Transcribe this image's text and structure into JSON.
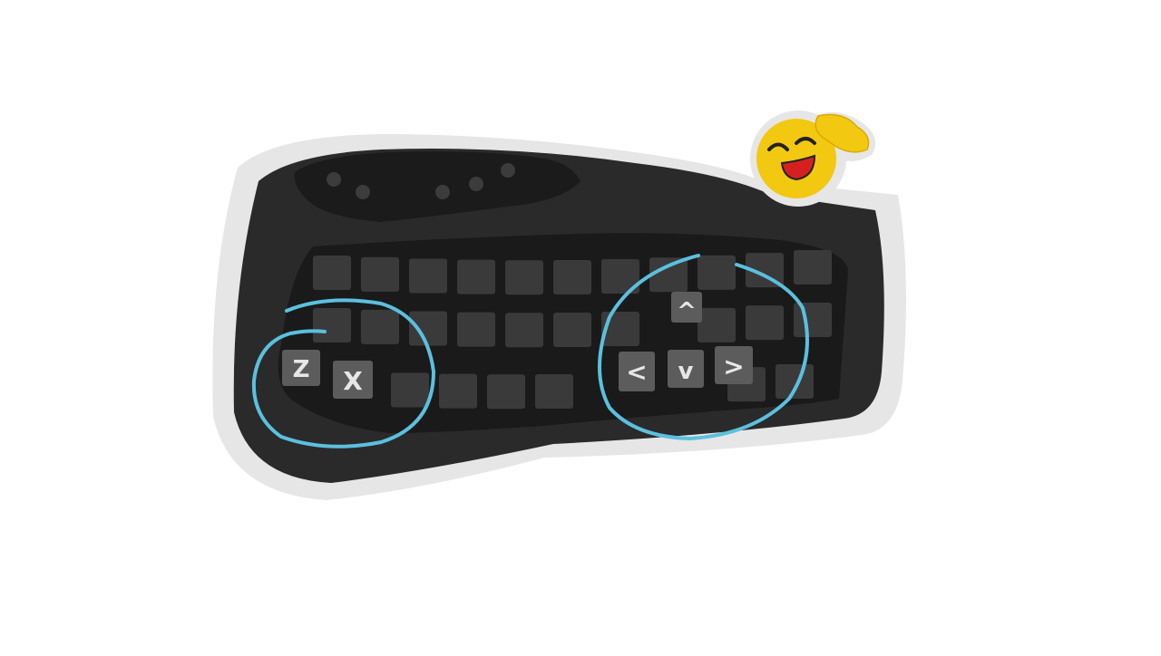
{
  "colors": {
    "background": "#ffffff",
    "sticker_outline": "#e6e6e6",
    "keyboard_body": "#2a2a2a",
    "keyboard_top": "#1b1b1b",
    "key_well": "#1a1a1a",
    "key_dark": "#3a3a3a",
    "key_highlight": "#5c5c5c",
    "key_label": "#e6e6e6",
    "circle_annotation": "#5bc0de",
    "emoji_yellow": "#f2c811",
    "emoji_mouth": "#d62020"
  },
  "icons": {
    "emoji": "laughing-face-with-hand-icon"
  },
  "keys": {
    "left": [
      {
        "label": "Z",
        "name": "z-key"
      },
      {
        "label": "X",
        "name": "x-key"
      }
    ],
    "arrows": {
      "up": "^",
      "left": "<",
      "down": "v",
      "right": ">"
    }
  }
}
